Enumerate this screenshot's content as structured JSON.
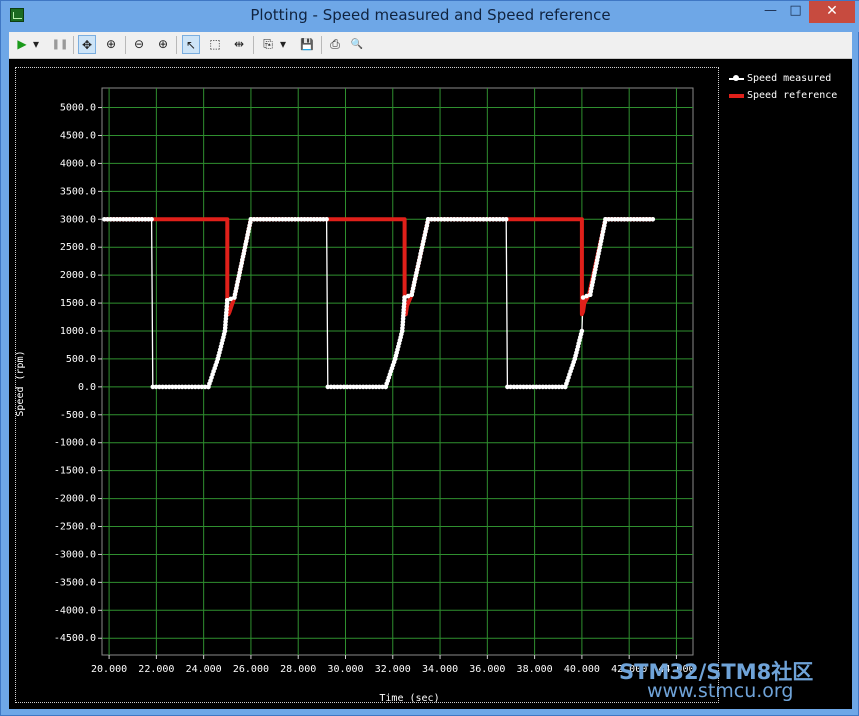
{
  "window": {
    "title": "Plotting  - Speed measured and Speed reference",
    "minimize": "—",
    "maximize": "□",
    "close": "✕"
  },
  "toolbar": {
    "items": [
      {
        "name": "run-icon",
        "glyph": "▶"
      },
      {
        "name": "run-dropdown-icon",
        "glyph": "▾"
      },
      {
        "name": "pause-icon",
        "glyph": "❚❚"
      },
      {
        "name": "pan-icon",
        "glyph": "✥"
      },
      {
        "name": "zoom-fit-icon",
        "glyph": "⊕"
      },
      {
        "name": "zoom-out-icon",
        "glyph": "⊖"
      },
      {
        "name": "zoom-in-icon",
        "glyph": "⊕"
      },
      {
        "name": "select-pointer-icon",
        "glyph": "↖"
      },
      {
        "name": "select-rect-icon",
        "glyph": "⬚"
      },
      {
        "name": "cursor-split-icon",
        "glyph": "⇹"
      },
      {
        "name": "copy-icon",
        "glyph": "⎘"
      },
      {
        "name": "copy-dropdown-icon",
        "glyph": "▾"
      },
      {
        "name": "save-icon",
        "glyph": "💾"
      },
      {
        "name": "print-icon",
        "glyph": "⎙"
      },
      {
        "name": "print-preview-icon",
        "glyph": "🔍"
      }
    ]
  },
  "colors": {
    "plot_bg": "#000000",
    "grid": "#2f8f2f",
    "measured": "#ffffff",
    "reference": "#e0201a"
  },
  "chart_data": {
    "type": "line",
    "xlabel": "Time (sec)",
    "ylabel": "Speed (rpm)",
    "xlim": [
      19.7,
      44.7
    ],
    "ylim": [
      -4800,
      5350
    ],
    "x_ticks": [
      "20.000",
      "22.000",
      "24.000",
      "26.000",
      "28.000",
      "30.000",
      "32.000",
      "34.000",
      "36.000",
      "38.000",
      "40.000",
      "42.000",
      "44.000"
    ],
    "y_ticks": [
      "5000.0",
      "4500.0",
      "4000.0",
      "3500.0",
      "3000.0",
      "2500.0",
      "2000.0",
      "1500.0",
      "1000.0",
      "500.0",
      "0.0",
      "-500.0",
      "-1000.0",
      "-1500.0",
      "-2000.0",
      "-2500.0",
      "-3000.0",
      "-3500.0",
      "-4000.0",
      "-4500.0"
    ],
    "grid": true,
    "legend_position": "right",
    "series": [
      {
        "name": "Speed measured",
        "color": "#ffffff",
        "marker": "circle",
        "x": [
          19.8,
          21.8,
          21.85,
          24.2,
          24.6,
          24.9,
          25.0,
          25.3,
          26.0,
          29.2,
          29.25,
          31.7,
          32.1,
          32.4,
          32.5,
          32.8,
          33.5,
          36.8,
          36.85,
          39.3,
          39.7,
          40.0,
          40.05,
          40.35,
          41.0,
          43.0
        ],
        "y": [
          3000,
          3000,
          0,
          0,
          500,
          1000,
          1550,
          1600,
          3000,
          3000,
          0,
          0,
          500,
          1000,
          1600,
          1650,
          3000,
          3000,
          0,
          0,
          500,
          1000,
          1600,
          1650,
          3000,
          3000
        ]
      },
      {
        "name": "Speed reference",
        "color": "#e0201a",
        "marker": "none",
        "x": [
          19.8,
          25.0,
          25.0,
          25.05,
          25.1,
          25.3,
          26.0,
          29.3,
          32.5,
          32.5,
          32.55,
          32.6,
          32.8,
          33.5,
          36.9,
          40.0,
          40.0,
          40.05,
          40.1,
          40.3,
          41.0,
          43.0
        ],
        "y": [
          3000,
          3000,
          1300,
          1300,
          1350,
          1600,
          3000,
          3000,
          3000,
          1300,
          1300,
          1450,
          1650,
          3000,
          3000,
          3000,
          1300,
          1350,
          1500,
          1650,
          3000,
          3000
        ]
      }
    ]
  }
}
